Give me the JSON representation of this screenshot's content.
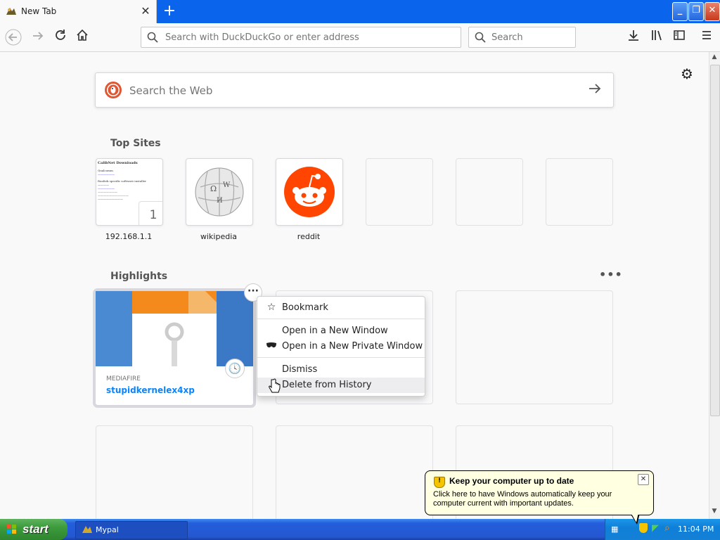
{
  "window": {
    "tab_title": "New Tab",
    "new_tab_icon": "+"
  },
  "toolbar": {
    "url_placeholder": "Search with DuckDuckGo or enter address",
    "search_placeholder": "Search"
  },
  "newtab": {
    "websearch_placeholder": "Search the Web",
    "top_sites_title": "Top Sites",
    "top_sites": [
      {
        "label": "192.168.1.1",
        "badge": "1"
      },
      {
        "label": "wikipedia"
      },
      {
        "label": "reddit"
      }
    ],
    "screenshot_text": {
      "heading": "CalibNet Downloads",
      "line1": "Qualcomm",
      "line2": "Realtek specific software installer"
    },
    "highlights_title": "Highlights",
    "highlight": {
      "source": "MEDIAFIRE",
      "title": "stupidkernelex4xp"
    },
    "context_menu": [
      {
        "label": "Bookmark",
        "icon": "star-icon"
      },
      {
        "label": "Open in a New Window"
      },
      {
        "label": "Open in a New Private Window",
        "icon": "mask-icon"
      },
      {
        "label": "Dismiss"
      },
      {
        "label": "Delete from History"
      }
    ]
  },
  "notification": {
    "title": "Keep your computer up to date",
    "text": "Click here to have Windows automatically keep your computer current with important updates."
  },
  "taskbar": {
    "start_label": "start",
    "task_label": "Mypal",
    "clock": "11:04 PM"
  },
  "colors": {
    "accent": "#0a84ff",
    "reddit": "#ff4500",
    "xp_blue": "#245edb",
    "xp_green": "#3c9b3c"
  }
}
